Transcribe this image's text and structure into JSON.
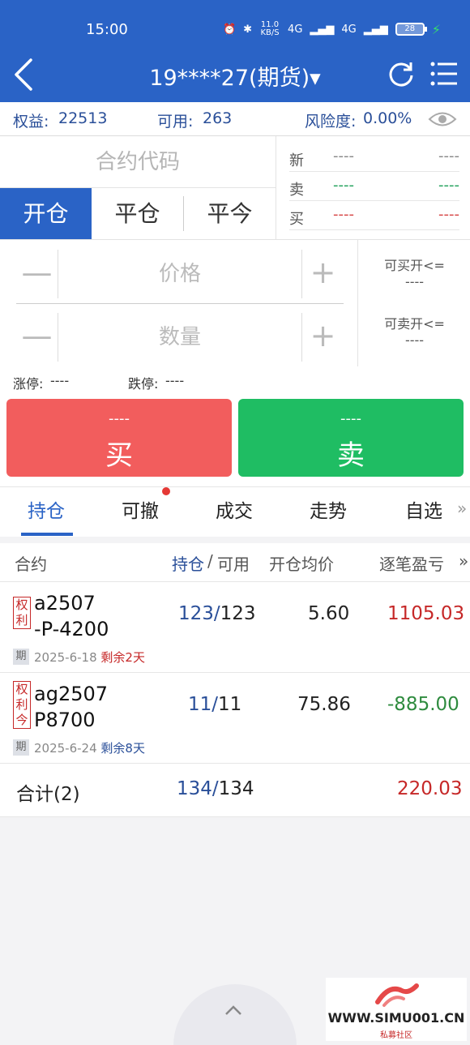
{
  "status_bar": {
    "time": "15:00",
    "network_speed": "11.0 KB/S",
    "signal1": "4G",
    "signal2": "4G",
    "battery": "28"
  },
  "header": {
    "title": "19****27(期货)▾",
    "accent": "#2a63c6"
  },
  "account": {
    "equity_label": "权益:",
    "equity": "22513",
    "available_label": "可用:",
    "available": "263",
    "risk_label": "风险度:",
    "risk": "0.00%"
  },
  "entry": {
    "code_placeholder": "合约代码",
    "tabs": [
      "开仓",
      "平仓",
      "平今"
    ],
    "quote": [
      {
        "label": "新",
        "v1": "----",
        "v2": "----",
        "color": "#888888"
      },
      {
        "label": "卖",
        "v1": "----",
        "v2": "----",
        "color": "#1fa05a"
      },
      {
        "label": "买",
        "v1": "----",
        "v2": "----",
        "color": "#d64545"
      }
    ],
    "price_placeholder": "价格",
    "qty_placeholder": "数量",
    "minus": "—",
    "plus": "+",
    "can_buy_label": "可买开<=",
    "can_buy_value": "----",
    "can_sell_label": "可卖开<=",
    "can_sell_value": "----",
    "limit_up_label": "涨停:",
    "limit_up": "----",
    "limit_down_label": "跌停:",
    "limit_down": "----"
  },
  "actions": {
    "buy_dash": "----",
    "buy_label": "买",
    "sell_dash": "----",
    "sell_label": "卖",
    "buy_color": "#f25d5d",
    "sell_color": "#1fbd63"
  },
  "tabs": [
    "持仓",
    "可撤",
    "成交",
    "走势",
    "自选"
  ],
  "tabs_more": "»",
  "table": {
    "headers": {
      "contract": "合约",
      "pos": "持仓",
      "slash": "/",
      "avail": "可用",
      "avg": "开仓均价",
      "pnl": "逐笔盈亏",
      "more": "»"
    },
    "rows": [
      {
        "tag": [
          "权",
          "利"
        ],
        "line1": "a2507",
        "line2": "-P-4200",
        "period": "期",
        "expiry": "2025-6-18",
        "remain": "剩余2天",
        "pos": "123",
        "avail": "123",
        "avg": "5.60",
        "pnl": "1105.03"
      },
      {
        "tag": [
          "权",
          "利",
          "今"
        ],
        "line1": "ag2507",
        "line2": "P8700",
        "period": "期",
        "expiry": "2025-6-24",
        "remain": "剩余8天",
        "pos": "11",
        "avail": "11",
        "avg": "75.86",
        "pnl": "-885.00"
      }
    ],
    "total": {
      "label": "合计(2)",
      "pos": "134",
      "avail": "134",
      "pnl": "220.03"
    }
  },
  "watermark": {
    "url": "WWW.SIMU001.CN",
    "sub": "私募社区"
  }
}
